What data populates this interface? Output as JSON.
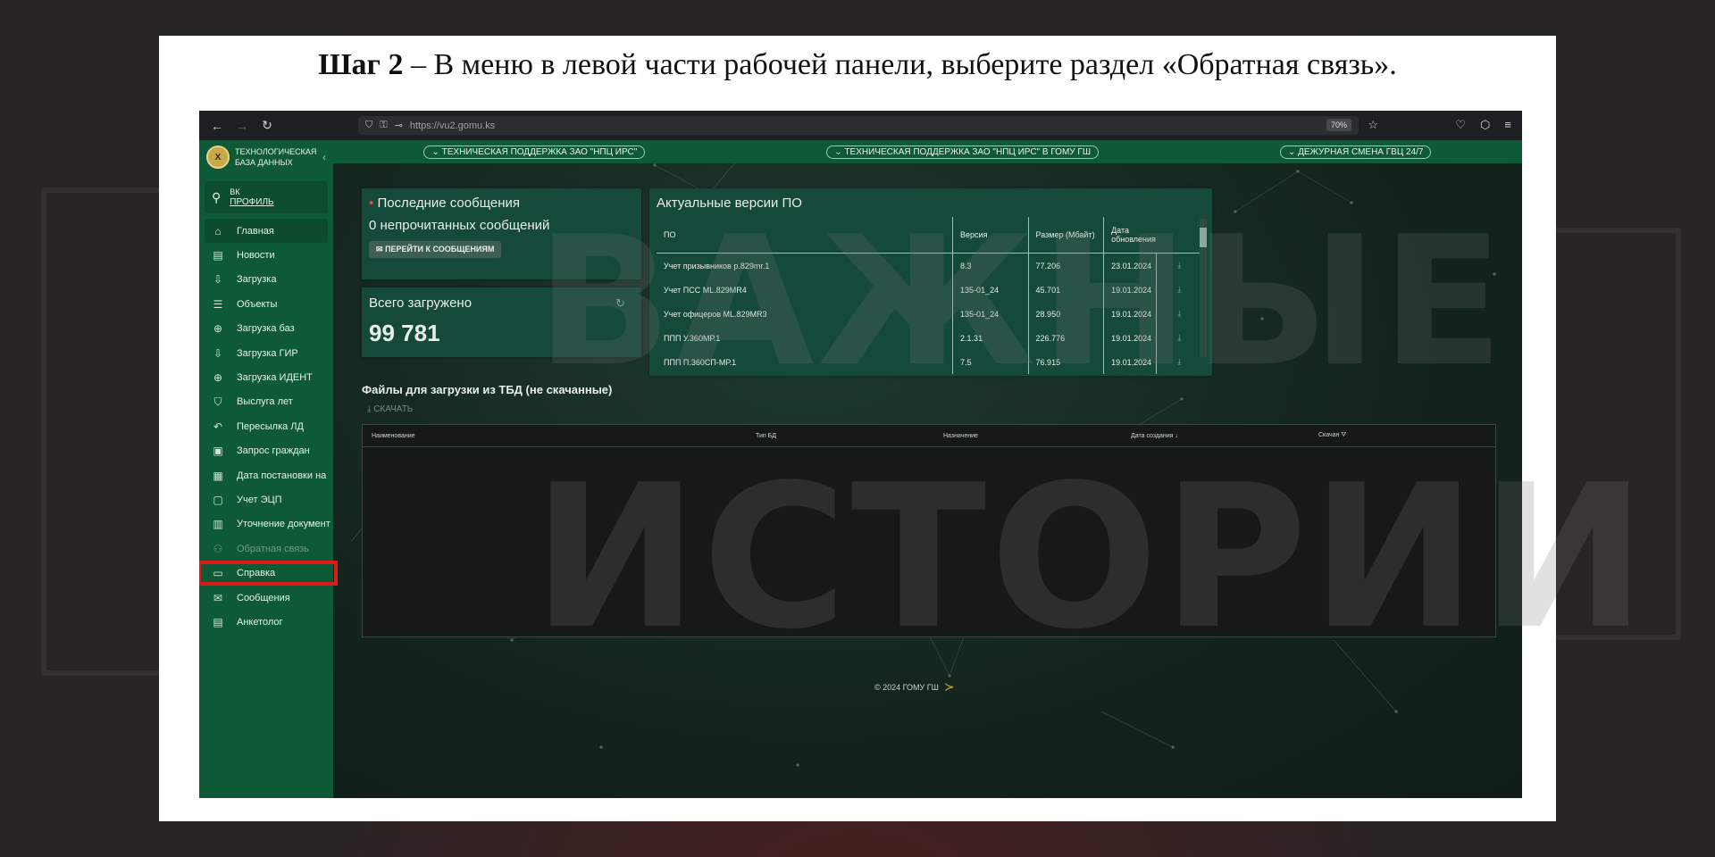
{
  "watermark": {
    "line1": "ВАЖНЫЕ",
    "line2": "ИСТОРИИ"
  },
  "caption": {
    "bold": "Шаг 2",
    "rest": " – В меню в левой части рабочей панели, выберите раздел «Обратная связь»."
  },
  "browser": {
    "url": "https://vu2.gomu.ks",
    "zoom": "70%"
  },
  "sidebar": {
    "logo_text": "ТЕХНОЛОГИЧЕСКАЯ БАЗА ДАННЫХ",
    "user_initials": "ВК",
    "profile_link": "ПРОФИЛЬ",
    "items": [
      {
        "label": "Главная",
        "icon": "home-icon",
        "glyph": "⌂"
      },
      {
        "label": "Новости",
        "icon": "news-icon",
        "glyph": "▤"
      },
      {
        "label": "Загрузка",
        "icon": "upload-icon",
        "glyph": "⇩"
      },
      {
        "label": "Объекты",
        "icon": "list-icon",
        "glyph": "☰"
      },
      {
        "label": "Загрузка баз",
        "icon": "database-upload-icon",
        "glyph": "⊕"
      },
      {
        "label": "Загрузка ГИР",
        "icon": "upload-gir-icon",
        "glyph": "⇩"
      },
      {
        "label": "Загрузка ИДЕНТ",
        "icon": "upload-ident-icon",
        "glyph": "⊕"
      },
      {
        "label": "Выслуга лет",
        "icon": "shield-icon",
        "glyph": "⛉"
      },
      {
        "label": "Пересылка ЛД",
        "icon": "forward-icon",
        "glyph": "↶"
      },
      {
        "label": "Запрос граждан",
        "icon": "briefcase-icon",
        "glyph": "▣"
      },
      {
        "label": "Дата постановки на",
        "icon": "calendar-icon",
        "glyph": "▦"
      },
      {
        "label": "Учет ЭЦП",
        "icon": "signature-icon",
        "glyph": "▢"
      },
      {
        "label": "Уточнение документ",
        "icon": "document-edit-icon",
        "glyph": "▥"
      },
      {
        "label": "Обратная связь",
        "icon": "feedback-icon",
        "glyph": "⚇"
      },
      {
        "label": "Справка",
        "icon": "folder-icon",
        "glyph": "▭"
      },
      {
        "label": "Сообщения",
        "icon": "mail-icon",
        "glyph": "✉"
      },
      {
        "label": "Анкетолог",
        "icon": "survey-icon",
        "glyph": "▤"
      }
    ]
  },
  "topbar": {
    "pill1": "ТЕХНИЧЕСКАЯ ПОДДЕРЖКА ЗАО \"НПЦ ИРС\"",
    "pill2": "ТЕХНИЧЕСКАЯ ПОДДЕРЖКА ЗАО \"НПЦ ИРС\" В ГОМУ ГШ",
    "pill3": "ДЕЖУРНАЯ СМЕНА ГВЦ 24/7"
  },
  "messages": {
    "title": "Последние сообщения",
    "unread": "0 непрочитанных сообщений",
    "button": "ПЕРЕЙТИ К СООБЩЕНИЯМ"
  },
  "total": {
    "title": "Всего загружено",
    "value": "99 781"
  },
  "versions": {
    "title": "Актуальные версии ПО",
    "headers": [
      "ПО",
      "Версия",
      "Размер (Мбайт)",
      "Дата обновления"
    ],
    "rows": [
      [
        "Учет призывников р.829mr.1",
        "8.3",
        "77.206",
        "23.01.2024"
      ],
      [
        "Учет ПСС ML.829MR4",
        "135-01_24",
        "45.701",
        "19.01.2024"
      ],
      [
        "Учет офицеров ML.829MR3",
        "135-01_24",
        "28.950",
        "19.01.2024"
      ],
      [
        "ППП У.360МР.1",
        "2.1.31",
        "226.776",
        "19.01.2024"
      ],
      [
        "ППП П.360СП-МР.1",
        "7.5",
        "76.915",
        "19.01.2024"
      ]
    ]
  },
  "files": {
    "title": "Файлы для загрузки из ТБД (не скачанные)",
    "download": "СКАЧАТЬ",
    "columns": [
      "Наименование",
      "Тип БД",
      "Назначение",
      "Дата создания ↓",
      "Скачан ⛛"
    ]
  },
  "footer": {
    "text": "© 2024 ГОМУ ГШ"
  }
}
